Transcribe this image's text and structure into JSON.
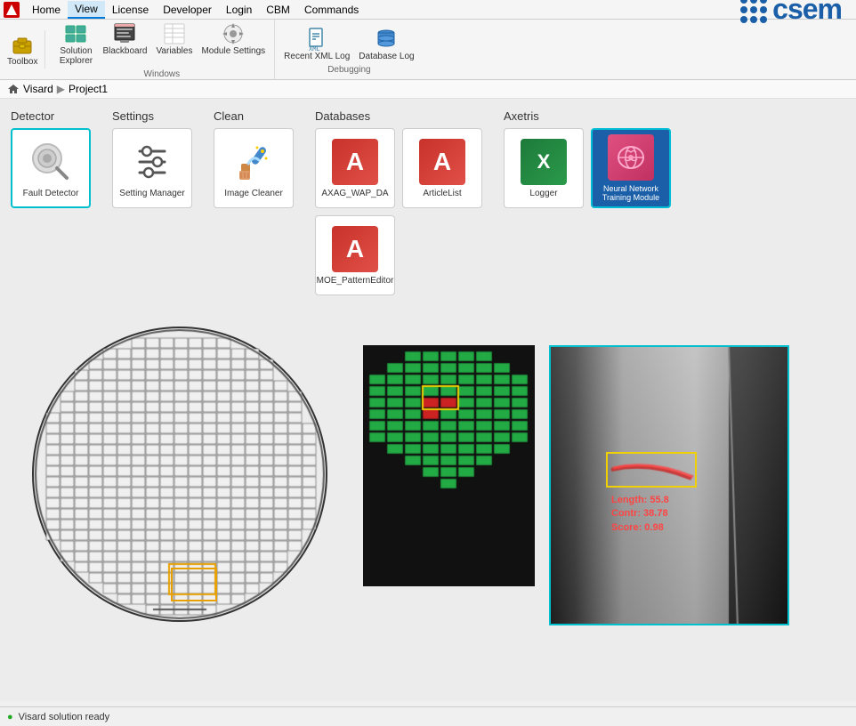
{
  "app": {
    "logo_text": "V",
    "csem_text": "csem"
  },
  "menubar": {
    "items": [
      {
        "id": "home",
        "label": "Home"
      },
      {
        "id": "view",
        "label": "View",
        "active": true
      },
      {
        "id": "license",
        "label": "License"
      },
      {
        "id": "developer",
        "label": "Developer"
      },
      {
        "id": "login",
        "label": "Login"
      },
      {
        "id": "cbm",
        "label": "CBM"
      },
      {
        "id": "commands",
        "label": "Commands"
      }
    ]
  },
  "toolbar": {
    "groups": [
      {
        "label": "",
        "items": [
          {
            "id": "toolbox",
            "label": "Toolbox",
            "icon": "🧰"
          }
        ]
      },
      {
        "label": "Windows",
        "items": [
          {
            "id": "solution-explorer",
            "label": "Solution Explorer",
            "icon": "📁"
          },
          {
            "id": "blackboard",
            "label": "Blackboard",
            "icon": "📋"
          },
          {
            "id": "variables",
            "label": "Variables",
            "icon": "📊"
          },
          {
            "id": "module-settings",
            "label": "Module Settings",
            "icon": "⚙️"
          }
        ]
      },
      {
        "label": "Debugging",
        "items": [
          {
            "id": "recent-xml-log",
            "label": "Recent XML Log",
            "icon": "📄"
          },
          {
            "id": "database-log",
            "label": "Database Log",
            "icon": "🗃️"
          }
        ]
      }
    ]
  },
  "breadcrumb": {
    "items": [
      "Visard",
      "Project1"
    ]
  },
  "modules": [
    {
      "section": "Detector",
      "selected": true,
      "cards": [
        {
          "id": "fault-detector",
          "label": "Fault Detector",
          "icon": "search"
        }
      ]
    },
    {
      "section": "Settings",
      "selected": false,
      "cards": [
        {
          "id": "setting-manager",
          "label": "Setting Manager",
          "icon": "sliders"
        }
      ]
    },
    {
      "section": "Clean",
      "selected": false,
      "cards": [
        {
          "id": "image-cleaner",
          "label": "Image Cleaner",
          "icon": "clean"
        }
      ]
    },
    {
      "section": "Databases",
      "selected": false,
      "cards": [
        {
          "id": "axag-wap-da",
          "label": "AXAG_WAP_DA",
          "icon": "access-red"
        },
        {
          "id": "articlelist",
          "label": "ArticleList",
          "icon": "access-red"
        },
        {
          "id": "moe-patterneditor",
          "label": "MOE_PatternEditor",
          "icon": "access-red"
        }
      ]
    },
    {
      "section": "Axetris",
      "selected": false,
      "cards": [
        {
          "id": "logger",
          "label": "Logger",
          "icon": "excel-green"
        },
        {
          "id": "neural-network",
          "label": "Neural Network Training Module",
          "icon": "neural"
        }
      ]
    }
  ],
  "detection": {
    "length_label": "Length: 55.8",
    "contr_label": "Contr: 38.78",
    "score_label": "Score: 0.98"
  },
  "statusbar": {
    "icon": "●",
    "text": "Visard solution ready"
  }
}
